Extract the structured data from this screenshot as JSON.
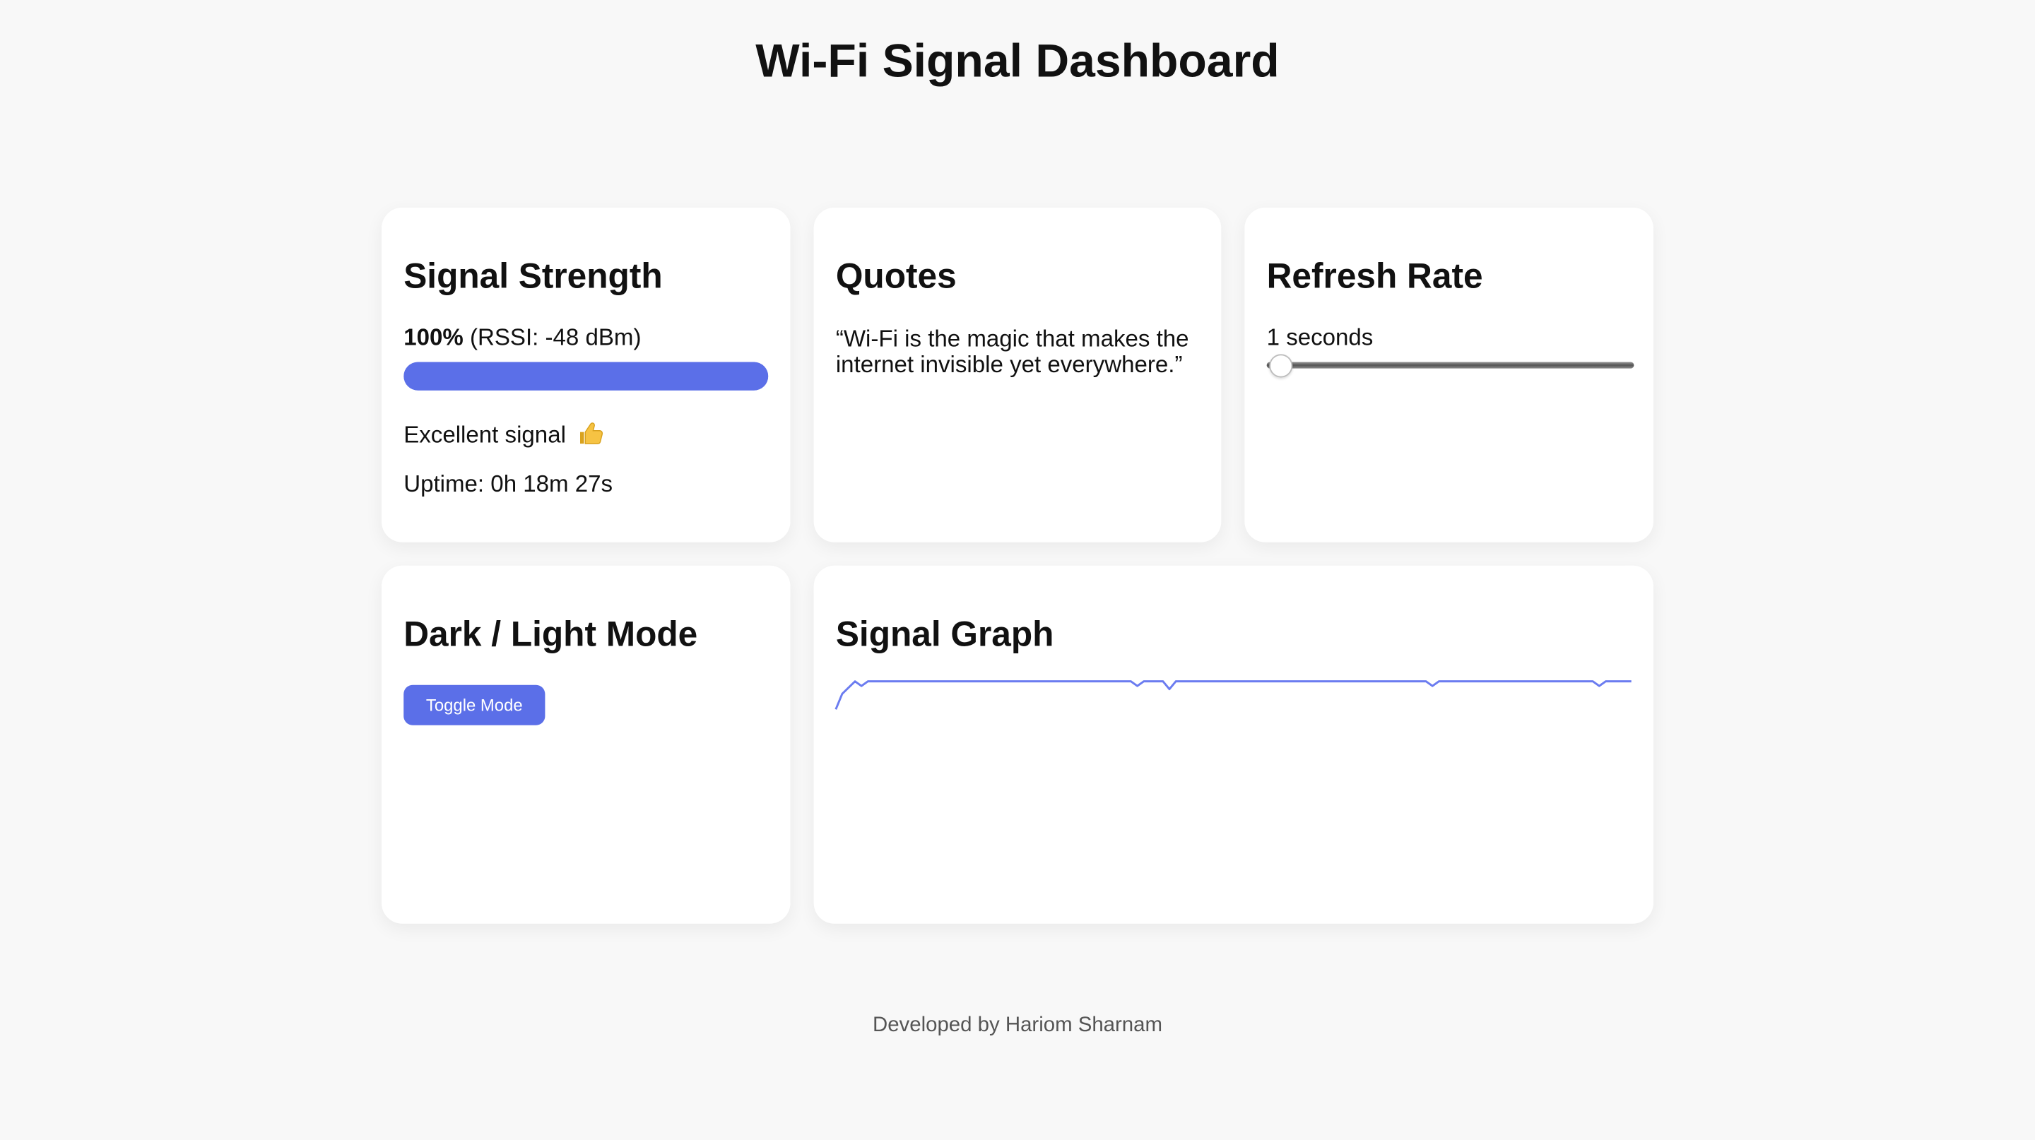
{
  "page": {
    "title": "Wi-Fi Signal Dashboard",
    "footer": "Developed by Hariom Sharnam"
  },
  "signal_strength": {
    "heading": "Signal Strength",
    "percent": "100%",
    "rssi_text": " (RSSI: -48 dBm)",
    "level": 100,
    "status": "Excellent signal",
    "status_icon": "thumbs-up-icon",
    "uptime": "Uptime: 0h 18m 27s"
  },
  "quotes": {
    "heading": "Quotes",
    "text": "“Wi-Fi is the magic that makes the internet invisible yet everywhere.”"
  },
  "refresh_rate": {
    "heading": "Refresh Rate",
    "value_label": "1 seconds",
    "slider_value": 1
  },
  "mode": {
    "heading": "Dark / Light Mode",
    "button_label": "Toggle Mode"
  },
  "signal_graph": {
    "heading": "Signal Graph"
  },
  "chart_data": {
    "type": "line",
    "title": "",
    "ylim": [
      0,
      100
    ],
    "values": [
      82,
      92,
      96,
      100,
      97,
      100,
      100,
      100,
      100,
      100,
      100,
      100,
      100,
      100,
      100,
      100,
      100,
      100,
      100,
      100,
      100,
      100,
      100,
      100,
      100,
      100,
      100,
      100,
      100,
      100,
      100,
      100,
      100,
      100,
      100,
      100,
      100,
      100,
      100,
      100,
      100,
      100,
      100,
      100,
      100,
      100,
      100,
      97,
      100,
      100,
      100,
      100,
      95,
      100,
      100,
      100,
      100,
      100,
      100,
      100,
      100,
      100,
      100,
      100,
      100,
      100,
      100,
      100,
      100,
      100,
      100,
      100,
      100,
      100,
      100,
      100,
      100,
      100,
      100,
      100,
      100,
      100,
      100,
      100,
      100,
      100,
      100,
      100,
      100,
      100,
      100,
      100,
      100,
      97,
      100,
      100,
      100,
      100,
      100,
      100,
      100,
      100,
      100,
      100,
      100,
      100,
      100,
      100,
      100,
      100,
      100,
      100,
      100,
      100,
      100,
      100,
      100,
      100,
      100,
      97,
      100,
      100,
      100,
      100,
      100
    ],
    "colors": {
      "line": "#6b7cf0"
    }
  },
  "colors": {
    "accent": "#5b6fe8",
    "background": "#f8f8f8",
    "card": "#ffffff"
  }
}
